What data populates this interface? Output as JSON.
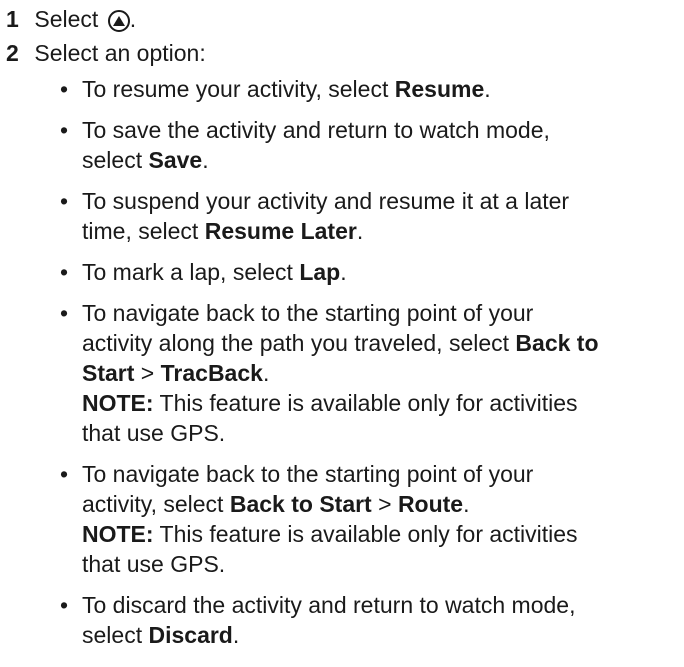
{
  "steps": [
    {
      "number": "1",
      "text_before": "Select",
      "icon": "triangle-up-in-circle-icon",
      "text_after": "."
    },
    {
      "number": "2",
      "text": "Select an option:"
    }
  ],
  "options": [
    {
      "lines": [
        "To resume your activity, select ",
        "Resume",
        "."
      ]
    },
    {
      "lines": [
        "To save the activity and return to watch mode,",
        "select ",
        "Save",
        "."
      ]
    },
    {
      "lines": [
        "To suspend your activity and resume it at a later",
        "time, select ",
        "Resume Later",
        "."
      ]
    },
    {
      "lines": [
        "To mark a lap, select ",
        "Lap",
        "."
      ]
    },
    {
      "lines": [
        "To navigate back to the starting point of your",
        "activity along the path you traveled, select ",
        "Back to",
        "Start",
        " > ",
        "TracBack",
        "."
      ],
      "note_label": "NOTE:",
      "note_text": " This feature is available only for activities",
      "note_text2": "that use GPS."
    },
    {
      "lines": [
        "To navigate back to the starting point of your",
        "activity, select ",
        "Back to Start",
        " > ",
        "Route",
        "."
      ],
      "note_label": "NOTE:",
      "note_text": " This feature is available only for activities",
      "note_text2": "that use GPS."
    },
    {
      "lines": [
        "To discard the activity and return to watch mode,",
        "select ",
        "Discard",
        "."
      ]
    }
  ]
}
